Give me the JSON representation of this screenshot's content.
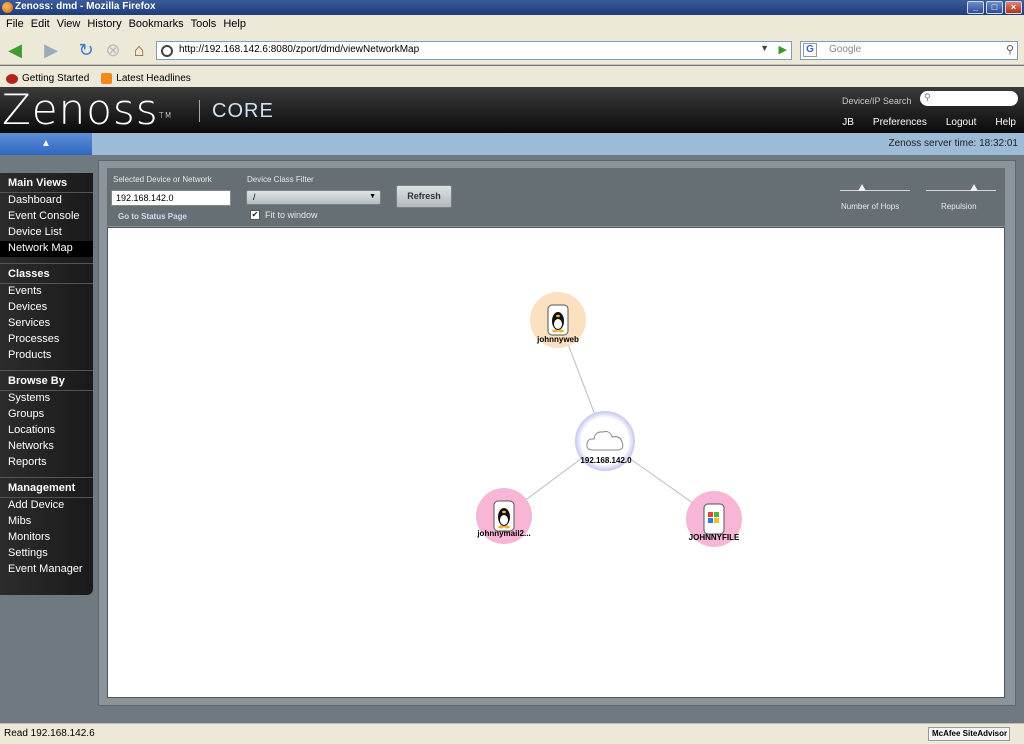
{
  "window": {
    "title": "Zenoss: dmd - Mozilla Firefox"
  },
  "menu": [
    "File",
    "Edit",
    "View",
    "History",
    "Bookmarks",
    "Tools",
    "Help"
  ],
  "nav": {
    "url": "http://192.168.142.6:8080/zport/dmd/viewNetworkMap",
    "search_placeholder": "Google"
  },
  "bookmarks": [
    "Getting Started",
    "Latest Headlines"
  ],
  "header": {
    "logo": "Zenoss",
    "logo_tm": "TM",
    "product": "CORE",
    "device_search_label": "Device/IP Search",
    "links": [
      "JB",
      "Preferences",
      "Logout",
      "Help"
    ]
  },
  "server_time": "Zenoss server time: 18:32:01",
  "sidebar": {
    "sections": [
      {
        "title": "Main Views",
        "items": [
          "Dashboard",
          "Event Console",
          "Device List",
          "Network Map"
        ]
      },
      {
        "title": "Classes",
        "items": [
          "Events",
          "Devices",
          "Services",
          "Processes",
          "Products"
        ]
      },
      {
        "title": "Browse By",
        "items": [
          "Systems",
          "Groups",
          "Locations",
          "Networks",
          "Reports"
        ]
      },
      {
        "title": "Management",
        "items": [
          "Add Device",
          "Mibs",
          "Monitors",
          "Settings",
          "Event Manager"
        ]
      }
    ],
    "selected": "Network Map"
  },
  "toolbar": {
    "selected_label": "Selected Device or Network",
    "selected_value": "192.168.142.0",
    "status_link": "Go to Status Page",
    "filter_label": "Device Class Filter",
    "filter_value": "/",
    "refresh": "Refresh",
    "fit_label": "Fit to window",
    "fit_checked": true,
    "hops_label": "Number of Hops",
    "repulsion_label": "Repulsion"
  },
  "map": {
    "nodes": [
      {
        "label": "johnnyweb",
        "icon": "linux-tux-icon",
        "color": "#fce0c0"
      },
      {
        "label": "192.168.142.0",
        "icon": "network-cloud-icon",
        "color": "#c8c8f0"
      },
      {
        "label": "johnnymail2...",
        "icon": "linux-tux-icon",
        "color": "#f7b6d6"
      },
      {
        "label": "JOHNNYFILE",
        "icon": "windows-icon",
        "color": "#f7b6d6"
      }
    ]
  },
  "status": {
    "text": "Read 192.168.142.6",
    "addon": "McAfee SiteAdvisor"
  }
}
